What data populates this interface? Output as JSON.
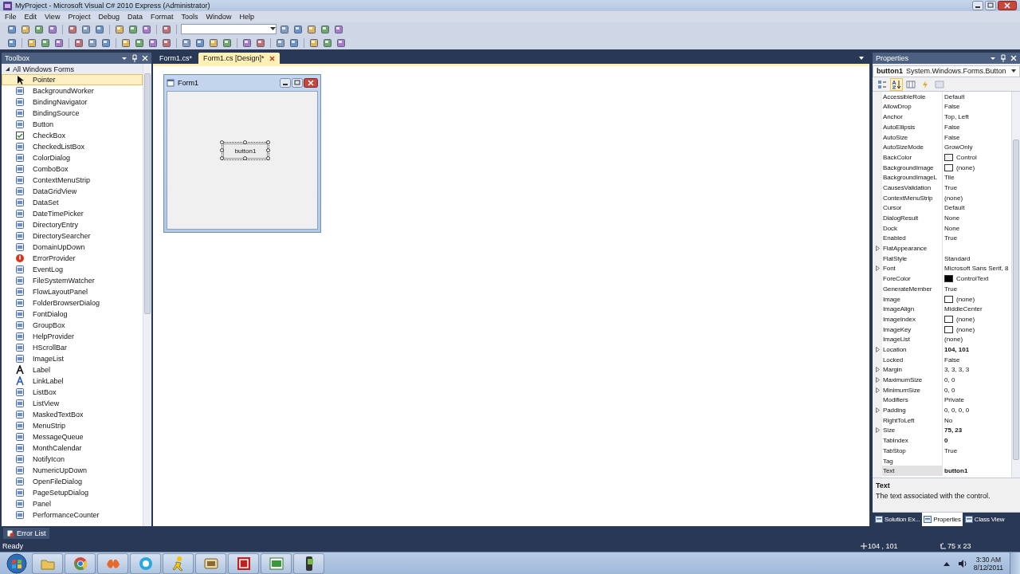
{
  "window": {
    "title": "MyProject - Microsoft Visual C# 2010 Express (Administrator)"
  },
  "menu": [
    "File",
    "Edit",
    "View",
    "Project",
    "Debug",
    "Data",
    "Format",
    "Tools",
    "Window",
    "Help"
  ],
  "toolbox": {
    "title": "Toolbox",
    "group": "All Windows Forms",
    "expanded": true,
    "items": [
      {
        "label": "Pointer",
        "kind": "pointer",
        "selected": true
      },
      {
        "label": "BackgroundWorker",
        "kind": "control",
        "selected": false
      },
      {
        "label": "BindingNavigator",
        "kind": "control",
        "selected": false
      },
      {
        "label": "BindingSource",
        "kind": "control",
        "selected": false
      },
      {
        "label": "Button",
        "kind": "control",
        "selected": false
      },
      {
        "label": "CheckBox",
        "kind": "check",
        "selected": false
      },
      {
        "label": "CheckedListBox",
        "kind": "control",
        "selected": false
      },
      {
        "label": "ColorDialog",
        "kind": "control",
        "selected": false
      },
      {
        "label": "ComboBox",
        "kind": "control",
        "selected": false
      },
      {
        "label": "ContextMenuStrip",
        "kind": "control",
        "selected": false
      },
      {
        "label": "DataGridView",
        "kind": "control",
        "selected": false
      },
      {
        "label": "DataSet",
        "kind": "control",
        "selected": false
      },
      {
        "label": "DateTimePicker",
        "kind": "control",
        "selected": false
      },
      {
        "label": "DirectoryEntry",
        "kind": "control",
        "selected": false
      },
      {
        "label": "DirectorySearcher",
        "kind": "control",
        "selected": false
      },
      {
        "label": "DomainUpDown",
        "kind": "control",
        "selected": false
      },
      {
        "label": "ErrorProvider",
        "kind": "error",
        "selected": false
      },
      {
        "label": "EventLog",
        "kind": "control",
        "selected": false
      },
      {
        "label": "FileSystemWatcher",
        "kind": "control",
        "selected": false
      },
      {
        "label": "FlowLayoutPanel",
        "kind": "control",
        "selected": false
      },
      {
        "label": "FolderBrowserDialog",
        "kind": "control",
        "selected": false
      },
      {
        "label": "FontDialog",
        "kind": "control",
        "selected": false
      },
      {
        "label": "GroupBox",
        "kind": "control",
        "selected": false
      },
      {
        "label": "HelpProvider",
        "kind": "control",
        "selected": false
      },
      {
        "label": "HScrollBar",
        "kind": "control",
        "selected": false
      },
      {
        "label": "ImageList",
        "kind": "control",
        "selected": false
      },
      {
        "label": "Label",
        "kind": "letter",
        "selected": false
      },
      {
        "label": "LinkLabel",
        "kind": "letter",
        "selected": false
      },
      {
        "label": "ListBox",
        "kind": "control",
        "selected": false
      },
      {
        "label": "ListView",
        "kind": "control",
        "selected": false
      },
      {
        "label": "MaskedTextBox",
        "kind": "control",
        "selected": false
      },
      {
        "label": "MenuStrip",
        "kind": "control",
        "selected": false
      },
      {
        "label": "MessageQueue",
        "kind": "control",
        "selected": false
      },
      {
        "label": "MonthCalendar",
        "kind": "control",
        "selected": false
      },
      {
        "label": "NotifyIcon",
        "kind": "control",
        "selected": false
      },
      {
        "label": "NumericUpDown",
        "kind": "control",
        "selected": false
      },
      {
        "label": "OpenFileDialog",
        "kind": "control",
        "selected": false
      },
      {
        "label": "PageSetupDialog",
        "kind": "control",
        "selected": false
      },
      {
        "label": "Panel",
        "kind": "control",
        "selected": false
      },
      {
        "label": "PerformanceCounter",
        "kind": "control",
        "selected": false
      }
    ]
  },
  "documents": {
    "tabs": [
      {
        "label": "Form1.cs*",
        "selected": false
      },
      {
        "label": "Form1.cs [Design]*",
        "selected": true
      }
    ]
  },
  "form": {
    "title": "Form1",
    "button": {
      "text": "button1",
      "selected": true
    }
  },
  "properties": {
    "title": "Properties",
    "object_name": "button1",
    "object_type": "System.Windows.Forms.Button",
    "toolbar": [
      {
        "kind": "categorized",
        "selected": false
      },
      {
        "kind": "alphabetical",
        "selected": true
      },
      {
        "kind": "properties",
        "selected": false
      },
      {
        "kind": "events",
        "selected": false
      },
      {
        "kind": "pages",
        "selected": false
      }
    ],
    "rows": [
      {
        "name": "AccessibleRole",
        "value": "Default",
        "expandable": false,
        "modified": false,
        "selected": false
      },
      {
        "name": "AllowDrop",
        "value": "False",
        "expandable": false,
        "modified": false,
        "selected": false
      },
      {
        "name": "Anchor",
        "value": "Top, Left",
        "expandable": false,
        "modified": false,
        "selected": false
      },
      {
        "name": "AutoEllipsis",
        "value": "False",
        "expandable": false,
        "modified": false,
        "selected": false
      },
      {
        "name": "AutoSize",
        "value": "False",
        "expandable": false,
        "modified": false,
        "selected": false
      },
      {
        "name": "AutoSizeMode",
        "value": "GrowOnly",
        "expandable": false,
        "modified": false,
        "selected": false
      },
      {
        "name": "BackColor",
        "value": "Control",
        "color": "#f0f0f0",
        "expandable": false,
        "modified": false,
        "selected": false
      },
      {
        "name": "BackgroundImage",
        "value": "(none)",
        "color": "#ffffff",
        "expandable": false,
        "modified": false,
        "selected": false
      },
      {
        "name": "BackgroundImageL",
        "value": "Tile",
        "expandable": false,
        "modified": false,
        "selected": false
      },
      {
        "name": "CausesValidation",
        "value": "True",
        "expandable": false,
        "modified": false,
        "selected": false
      },
      {
        "name": "ContextMenuStrip",
        "value": "(none)",
        "expandable": false,
        "modified": false,
        "selected": false
      },
      {
        "name": "Cursor",
        "value": "Default",
        "expandable": false,
        "modified": false,
        "selected": false
      },
      {
        "name": "DialogResult",
        "value": "None",
        "expandable": false,
        "modified": false,
        "selected": false
      },
      {
        "name": "Dock",
        "value": "None",
        "expandable": false,
        "modified": false,
        "selected": false
      },
      {
        "name": "Enabled",
        "value": "True",
        "expandable": false,
        "modified": false,
        "selected": false
      },
      {
        "name": "FlatAppearance",
        "expandable": true,
        "selected": false
      },
      {
        "name": "FlatStyle",
        "value": "Standard",
        "expandable": false,
        "modified": false,
        "selected": false
      },
      {
        "name": "Font",
        "value": "Microsoft Sans Serif, 8",
        "expandable": true,
        "modified": false,
        "selected": false
      },
      {
        "name": "ForeColor",
        "value": "ControlText",
        "color": "#000000",
        "expandable": false,
        "modified": false,
        "selected": false
      },
      {
        "name": "GenerateMember",
        "value": "True",
        "expandable": false,
        "modified": false,
        "selected": false
      },
      {
        "name": "Image",
        "value": "(none)",
        "color": "#ffffff",
        "expandable": false,
        "modified": false,
        "selected": false
      },
      {
        "name": "ImageAlign",
        "value": "MiddleCenter",
        "expandable": false,
        "modified": false,
        "selected": false
      },
      {
        "name": "ImageIndex",
        "value": "(none)",
        "color": "#ffffff",
        "expandable": false,
        "modified": false,
        "selected": false
      },
      {
        "name": "ImageKey",
        "value": "(none)",
        "color": "#ffffff",
        "expandable": false,
        "modified": false,
        "selected": false
      },
      {
        "name": "ImageList",
        "value": "(none)",
        "expandable": false,
        "modified": false,
        "selected": false
      },
      {
        "name": "Location",
        "value": "104, 101",
        "expandable": true,
        "modified": true,
        "selected": false
      },
      {
        "name": "Locked",
        "value": "False",
        "expandable": false,
        "modified": false,
        "selected": false
      },
      {
        "name": "Margin",
        "value": "3, 3, 3, 3",
        "expandable": true,
        "modified": false,
        "selected": false
      },
      {
        "name": "MaximumSize",
        "value": "0, 0",
        "expandable": true,
        "modified": false,
        "selected": false
      },
      {
        "name": "MinimumSize",
        "value": "0, 0",
        "expandable": true,
        "modified": false,
        "selected": false
      },
      {
        "name": "Modifiers",
        "value": "Private",
        "expandable": false,
        "modified": false,
        "selected": false
      },
      {
        "name": "Padding",
        "value": "0, 0, 0, 0",
        "expandable": true,
        "modified": false,
        "selected": false
      },
      {
        "name": "RightToLeft",
        "value": "No",
        "expandable": false,
        "modified": false,
        "selected": false
      },
      {
        "name": "Size",
        "value": "75, 23",
        "expandable": true,
        "modified": true,
        "selected": false
      },
      {
        "name": "TabIndex",
        "value": "0",
        "expandable": false,
        "modified": true,
        "selected": false
      },
      {
        "name": "TabStop",
        "value": "True",
        "expandable": false,
        "modified": false,
        "selected": false
      },
      {
        "name": "Tag",
        "expandable": false,
        "selected": false
      },
      {
        "name": "Text",
        "value": "button1",
        "expandable": false,
        "modified": true,
        "selected": true
      }
    ],
    "description": {
      "title": "Text",
      "text": "The text associated with the control."
    },
    "tabs": [
      {
        "label": "Solution Ex...",
        "selected": false
      },
      {
        "label": "Properties",
        "selected": true
      },
      {
        "label": "Class View",
        "selected": false
      }
    ]
  },
  "error_list": {
    "label": "Error List"
  },
  "status": {
    "text": "Ready",
    "location": "104 , 101",
    "size": "75 x 23"
  },
  "clock": {
    "time": "3:30 AM",
    "date": "8/12/2011"
  }
}
